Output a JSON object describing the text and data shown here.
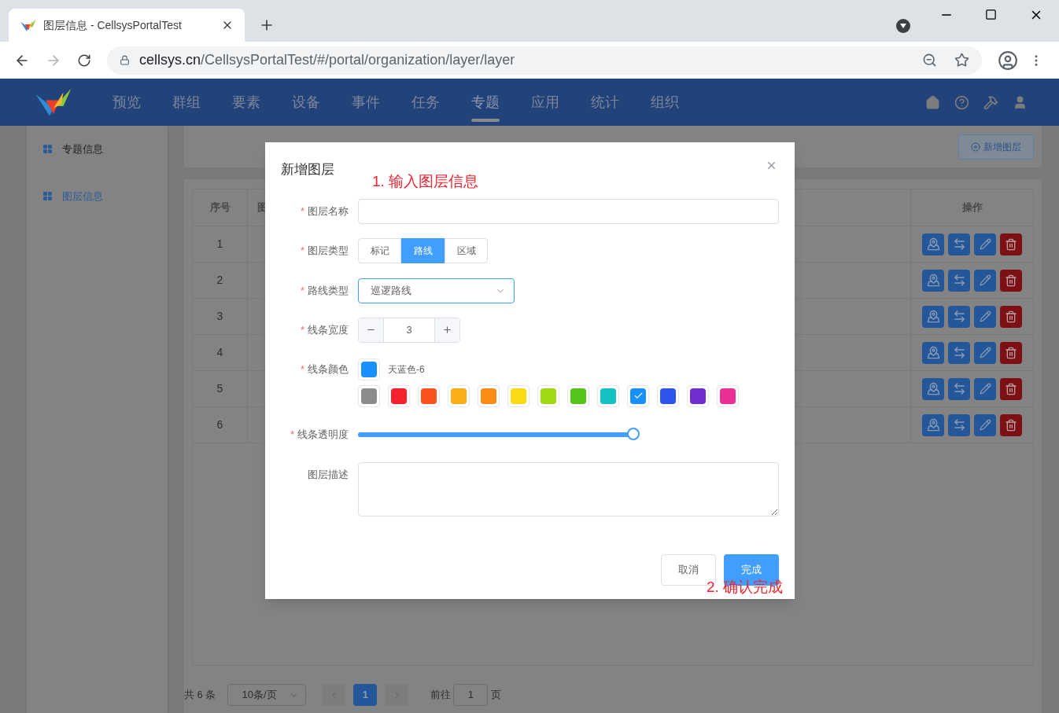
{
  "browser": {
    "tab_title": "图层信息 - CellsysPortalTest",
    "url_host": "cellsys.cn",
    "url_path": "/CellsysPortalTest/#/portal/organization/layer/layer"
  },
  "nav": {
    "items": [
      {
        "label": "预览",
        "selected": false
      },
      {
        "label": "群组",
        "selected": false
      },
      {
        "label": "要素",
        "selected": false
      },
      {
        "label": "设备",
        "selected": false
      },
      {
        "label": "事件",
        "selected": false
      },
      {
        "label": "任务",
        "selected": false
      },
      {
        "label": "专题",
        "selected": true
      },
      {
        "label": "应用",
        "selected": false
      },
      {
        "label": "统计",
        "selected": false
      },
      {
        "label": "组织",
        "selected": false
      }
    ]
  },
  "sidebar": {
    "items": [
      {
        "label": "专题信息",
        "selected": false
      },
      {
        "label": "图层信息",
        "selected": true
      }
    ]
  },
  "add_button": "新增图层",
  "table": {
    "columns": [
      "序号",
      "图",
      "操作"
    ],
    "rows": [
      {
        "index": "1"
      },
      {
        "index": "2"
      },
      {
        "index": "3"
      },
      {
        "index": "4"
      },
      {
        "index": "5"
      },
      {
        "index": "6"
      }
    ]
  },
  "pagination": {
    "total": "共 6 条",
    "page_size": "10条/页",
    "pages": [
      {
        "label": "1",
        "selected": true
      }
    ],
    "goto_label": "前往",
    "goto_value": "1",
    "goto_suffix": "页"
  },
  "dialog": {
    "title": "新增图层",
    "annotations": [
      "1. 输入图层信息",
      "2. 确认完成"
    ],
    "required_mark": "*",
    "name": {
      "label": "图层名称",
      "required": true
    },
    "layer_type": {
      "label": "图层类型",
      "required": true,
      "options": [
        {
          "label": "标记",
          "selected": false
        },
        {
          "label": "路线",
          "selected": true
        },
        {
          "label": "区域",
          "selected": false
        }
      ]
    },
    "route_type": {
      "label": "路线类型",
      "required": true,
      "value": "巡逻路线"
    },
    "line_width": {
      "label": "线条宽度",
      "required": true,
      "value": "3"
    },
    "line_color": {
      "label": "线条颜色",
      "required": true,
      "current_name": "天蓝色-6",
      "swatches": [
        {
          "color": "#8c8c8c",
          "selected": false
        },
        {
          "color": "#f5222d",
          "selected": false
        },
        {
          "color": "#fa541c",
          "selected": false
        },
        {
          "color": "#faad14",
          "selected": false
        },
        {
          "color": "#fa8c16",
          "selected": false
        },
        {
          "color": "#fadb14",
          "selected": false
        },
        {
          "color": "#a0d911",
          "selected": false
        },
        {
          "color": "#52c41a",
          "selected": false
        },
        {
          "color": "#13c2c2",
          "selected": false
        },
        {
          "color": "#1890ff",
          "selected": true
        },
        {
          "color": "#2f54eb",
          "selected": false
        },
        {
          "color": "#722ed1",
          "selected": false
        },
        {
          "color": "#eb2f96",
          "selected": false
        }
      ]
    },
    "opacity": {
      "label": "线条透明度",
      "required": true,
      "level": 1
    },
    "description": {
      "label": "图层描述",
      "required": false
    },
    "cancel": "取消",
    "confirm": "完成"
  }
}
